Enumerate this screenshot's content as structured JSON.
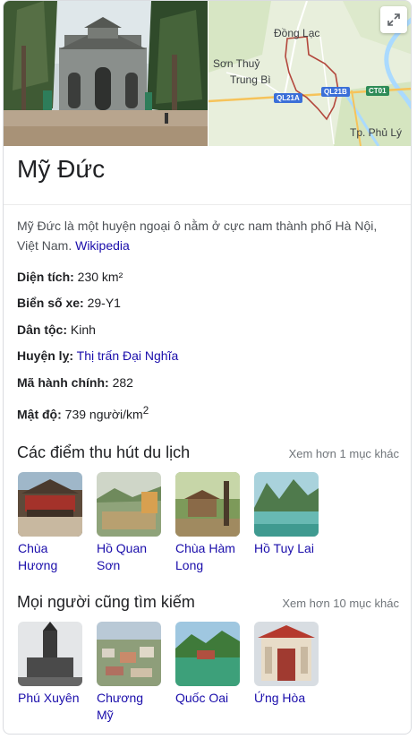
{
  "place": {
    "title": "Mỹ Đức",
    "description": "Mỹ Đức là một huyện ngoại ô nằm ở cực nam thành phố Hà Nội, Việt Nam.",
    "source_link": "Wikipedia"
  },
  "map": {
    "labels": {
      "dong_lac": "Đồng Lạc",
      "son_thuy": "Sơn Thuỷ",
      "trung_bi": "Trung Bì",
      "tp_phu_ly": "Tp. Phủ Lý"
    },
    "road_badges": {
      "ql21a": "QL21A",
      "ql21b": "QL21B",
      "ct01": "CT01"
    }
  },
  "facts": [
    {
      "label": "Diện tích:",
      "value": "230 km²"
    },
    {
      "label": "Biển số xe:",
      "value": "29-Y1"
    },
    {
      "label": "Dân tộc:",
      "value": "Kinh"
    },
    {
      "label": "Huyện lỵ:",
      "value": "Thị trấn Đại Nghĩa"
    },
    {
      "label": "Mã hành chính:",
      "value": "282"
    },
    {
      "label": "Mật độ:",
      "value": "739 người/km",
      "sup": "2"
    }
  ],
  "attractions": {
    "title": "Các điểm thu hút du lịch",
    "more": "Xem hơn 1 mục khác",
    "items": [
      {
        "line1": "Chùa",
        "line2": "Hương"
      },
      {
        "line1": "Hồ Quan",
        "line2": "Sơn"
      },
      {
        "line1": "Chùa Hàm",
        "line2": "Long"
      },
      {
        "line1": "Hồ Tuy Lai",
        "line2": ""
      }
    ]
  },
  "also_search": {
    "title": "Mọi người cũng tìm kiếm",
    "more": "Xem hơn 10 mục khác",
    "items": [
      {
        "line1": "Phú Xuyên",
        "line2": ""
      },
      {
        "line1": "Chương",
        "line2": "Mỹ"
      },
      {
        "line1": "Quốc Oai",
        "line2": ""
      },
      {
        "line1": "Ứng Hòa",
        "line2": ""
      }
    ]
  }
}
